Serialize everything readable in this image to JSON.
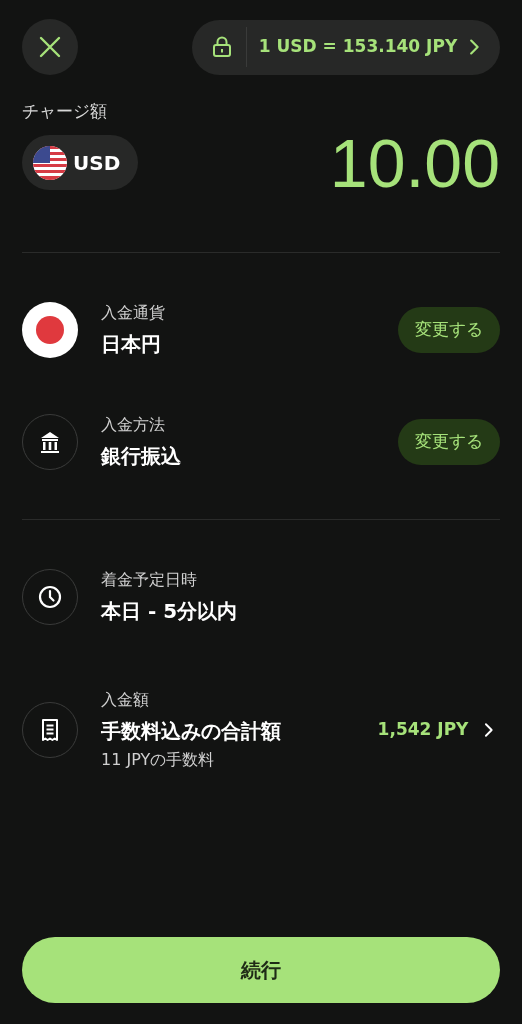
{
  "rate_button": {
    "label": "1 USD = 153.140 JPY"
  },
  "amount": {
    "label": "チャージ額",
    "currency": "USD",
    "value": "10.00"
  },
  "settings": [
    {
      "label": "入金通貨",
      "value": "日本円",
      "action": "変更する"
    },
    {
      "label": "入金方法",
      "value": "銀行振込",
      "action": "変更する"
    }
  ],
  "details": [
    {
      "label": "着金予定日時",
      "value": "本日 - 5分以内"
    },
    {
      "label": "入金額",
      "value": "手数料込みの合計額",
      "note": "11 JPYの手数料",
      "amount": "1,542 JPY"
    }
  ],
  "continue_button": "続行"
}
